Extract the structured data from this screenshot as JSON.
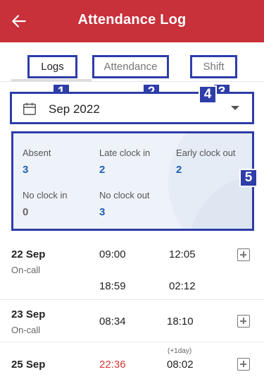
{
  "header": {
    "title": "Attendance Log"
  },
  "tabs": [
    {
      "label": "Logs",
      "badge": "1",
      "active": true
    },
    {
      "label": "Attendance",
      "badge": "2",
      "active": false
    },
    {
      "label": "Shift",
      "badge": "3",
      "active": false
    }
  ],
  "month_select": {
    "value": "Sep 2022",
    "badge": "4"
  },
  "summary": {
    "badge": "5",
    "stats": [
      {
        "label": "Absent",
        "value": "3"
      },
      {
        "label": "Late clock in",
        "value": "2"
      },
      {
        "label": "Early clock out",
        "value": "2"
      },
      {
        "label": "No clock in",
        "value": "0"
      },
      {
        "label": "No clock out",
        "value": "3"
      }
    ]
  },
  "logs": [
    {
      "date": "22 Sep",
      "tag": "On-call",
      "in1": "09:00",
      "out1": "12:05",
      "in2": "18:59",
      "out2": "02:12"
    },
    {
      "date": "23 Sep",
      "tag": "On-call",
      "in1": "08:34",
      "out1": "18:10"
    },
    {
      "date": "25 Sep",
      "in1": "22:36",
      "out1": "08:02",
      "out1_note": "(+1day)"
    }
  ],
  "colors": {
    "appbar": "#c8303a",
    "annotation": "#2e3da8",
    "value_blue": "#1e5fb3",
    "late_red": "#d33a3a"
  }
}
